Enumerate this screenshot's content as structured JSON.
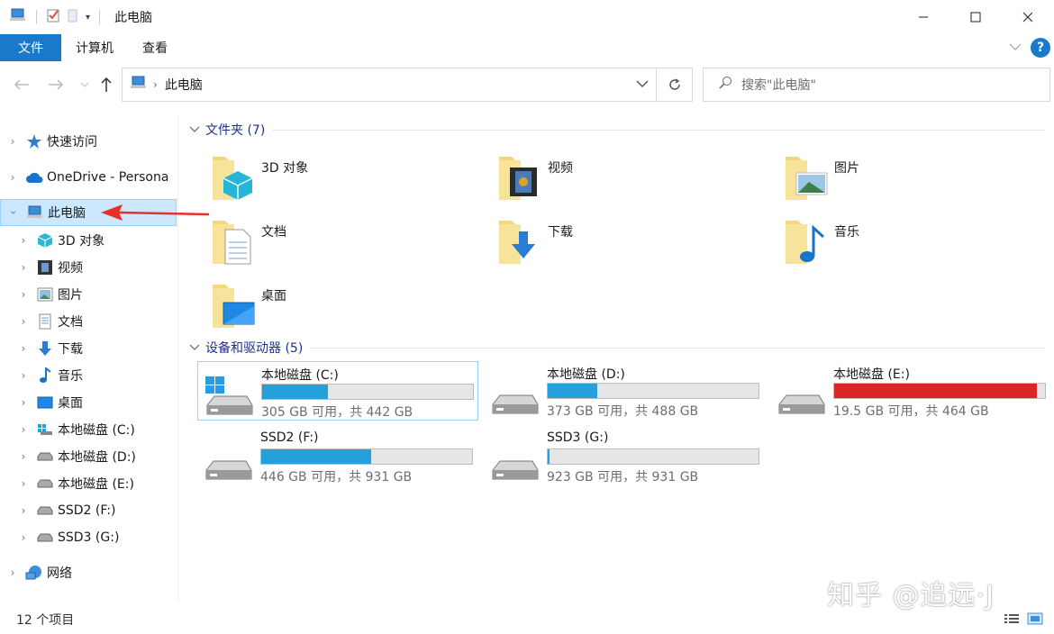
{
  "window": {
    "title": "此电脑",
    "controls": [
      "minimize-icon",
      "maximize-icon",
      "close-icon"
    ]
  },
  "ribbon": {
    "tabs": [
      {
        "label": "文件"
      },
      {
        "label": "计算机"
      },
      {
        "label": "查看"
      }
    ]
  },
  "address": {
    "path": "此电脑",
    "search_placeholder": "搜索\"此电脑\""
  },
  "sidebar": {
    "items": [
      {
        "label": "快速访问",
        "icon": "star-icon"
      },
      {
        "label": "OneDrive - Persona",
        "icon": "cloud-icon"
      },
      {
        "label": "此电脑",
        "icon": "computer-icon"
      },
      {
        "label": "3D 对象",
        "icon": "cube-icon"
      },
      {
        "label": "视频",
        "icon": "film-icon"
      },
      {
        "label": "图片",
        "icon": "picture-icon"
      },
      {
        "label": "文档",
        "icon": "document-icon"
      },
      {
        "label": "下载",
        "icon": "download-icon"
      },
      {
        "label": "音乐",
        "icon": "music-icon"
      },
      {
        "label": "桌面",
        "icon": "desktop-icon"
      },
      {
        "label": "本地磁盘 (C:)",
        "icon": "windows-drive-icon"
      },
      {
        "label": "本地磁盘 (D:)",
        "icon": "drive-icon"
      },
      {
        "label": "本地磁盘 (E:)",
        "icon": "drive-icon"
      },
      {
        "label": "SSD2 (F:)",
        "icon": "drive-icon"
      },
      {
        "label": "SSD3 (G:)",
        "icon": "drive-icon"
      },
      {
        "label": "网络",
        "icon": "network-icon"
      }
    ]
  },
  "folders_group": {
    "header": "文件夹 (7)",
    "items": [
      {
        "name": "3D 对象",
        "icon": "cube-icon"
      },
      {
        "name": "视频",
        "icon": "film-icon"
      },
      {
        "name": "图片",
        "icon": "picture-icon"
      },
      {
        "name": "文档",
        "icon": "document-icon"
      },
      {
        "name": "下载",
        "icon": "download-icon"
      },
      {
        "name": "音乐",
        "icon": "music-icon"
      },
      {
        "name": "桌面",
        "icon": "desktop-icon"
      }
    ]
  },
  "drives_group": {
    "header": "设备和驱动器 (5)",
    "items": [
      {
        "name": "本地磁盘 (C:)",
        "info": "305 GB 可用，共 442 GB",
        "used_fraction": 0.31,
        "icon": "windows-drive-icon"
      },
      {
        "name": "本地磁盘 (D:)",
        "info": "373 GB 可用，共 488 GB",
        "used_fraction": 0.235,
        "icon": "drive-icon"
      },
      {
        "name": "本地磁盘 (E:)",
        "info": "19.5 GB 可用，共 464 GB",
        "used_fraction": 0.96,
        "icon": "drive-icon"
      },
      {
        "name": "SSD2 (F:)",
        "info": "446 GB 可用，共 931 GB",
        "used_fraction": 0.52,
        "icon": "drive-icon"
      },
      {
        "name": "SSD3 (G:)",
        "info": "923 GB 可用，共 931 GB",
        "used_fraction": 0.01,
        "icon": "drive-icon"
      }
    ]
  },
  "status": {
    "item_count": "12 个项目"
  },
  "watermark": "知乎 @追远·J",
  "colors": {
    "accent": "#1979ca",
    "selection": "#cce8ff",
    "bar_normal": "#26a0da",
    "bar_full": "#da2626",
    "annotation_arrow": "#e8302a"
  }
}
